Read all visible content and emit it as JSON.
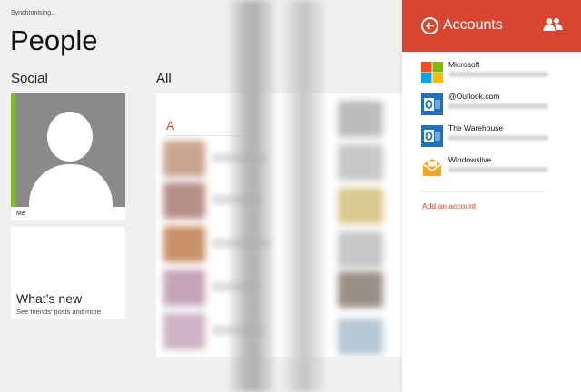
{
  "status": "Synchronising...",
  "page_title": "People",
  "social": {
    "heading": "Social",
    "me_label": "Me",
    "whats_new_title": "What’s new",
    "whats_new_sub": "See friends’ posts and more"
  },
  "all": {
    "heading": "All",
    "letter": "A"
  },
  "accounts": {
    "title": "Accounts",
    "items": [
      {
        "name": "Microsoft",
        "icon": "microsoft-icon"
      },
      {
        "name": "@Outlook.com",
        "icon": "outlook-icon"
      },
      {
        "name": "The Warehouse",
        "icon": "outlook-icon"
      },
      {
        "name": "Windowslive",
        "icon": "mail-icon"
      }
    ],
    "add_label": "Add an account"
  },
  "colors": {
    "accent": "#d9452e",
    "social_accent": "#7dbb2b",
    "outlook_blue": "#1e72bd"
  }
}
